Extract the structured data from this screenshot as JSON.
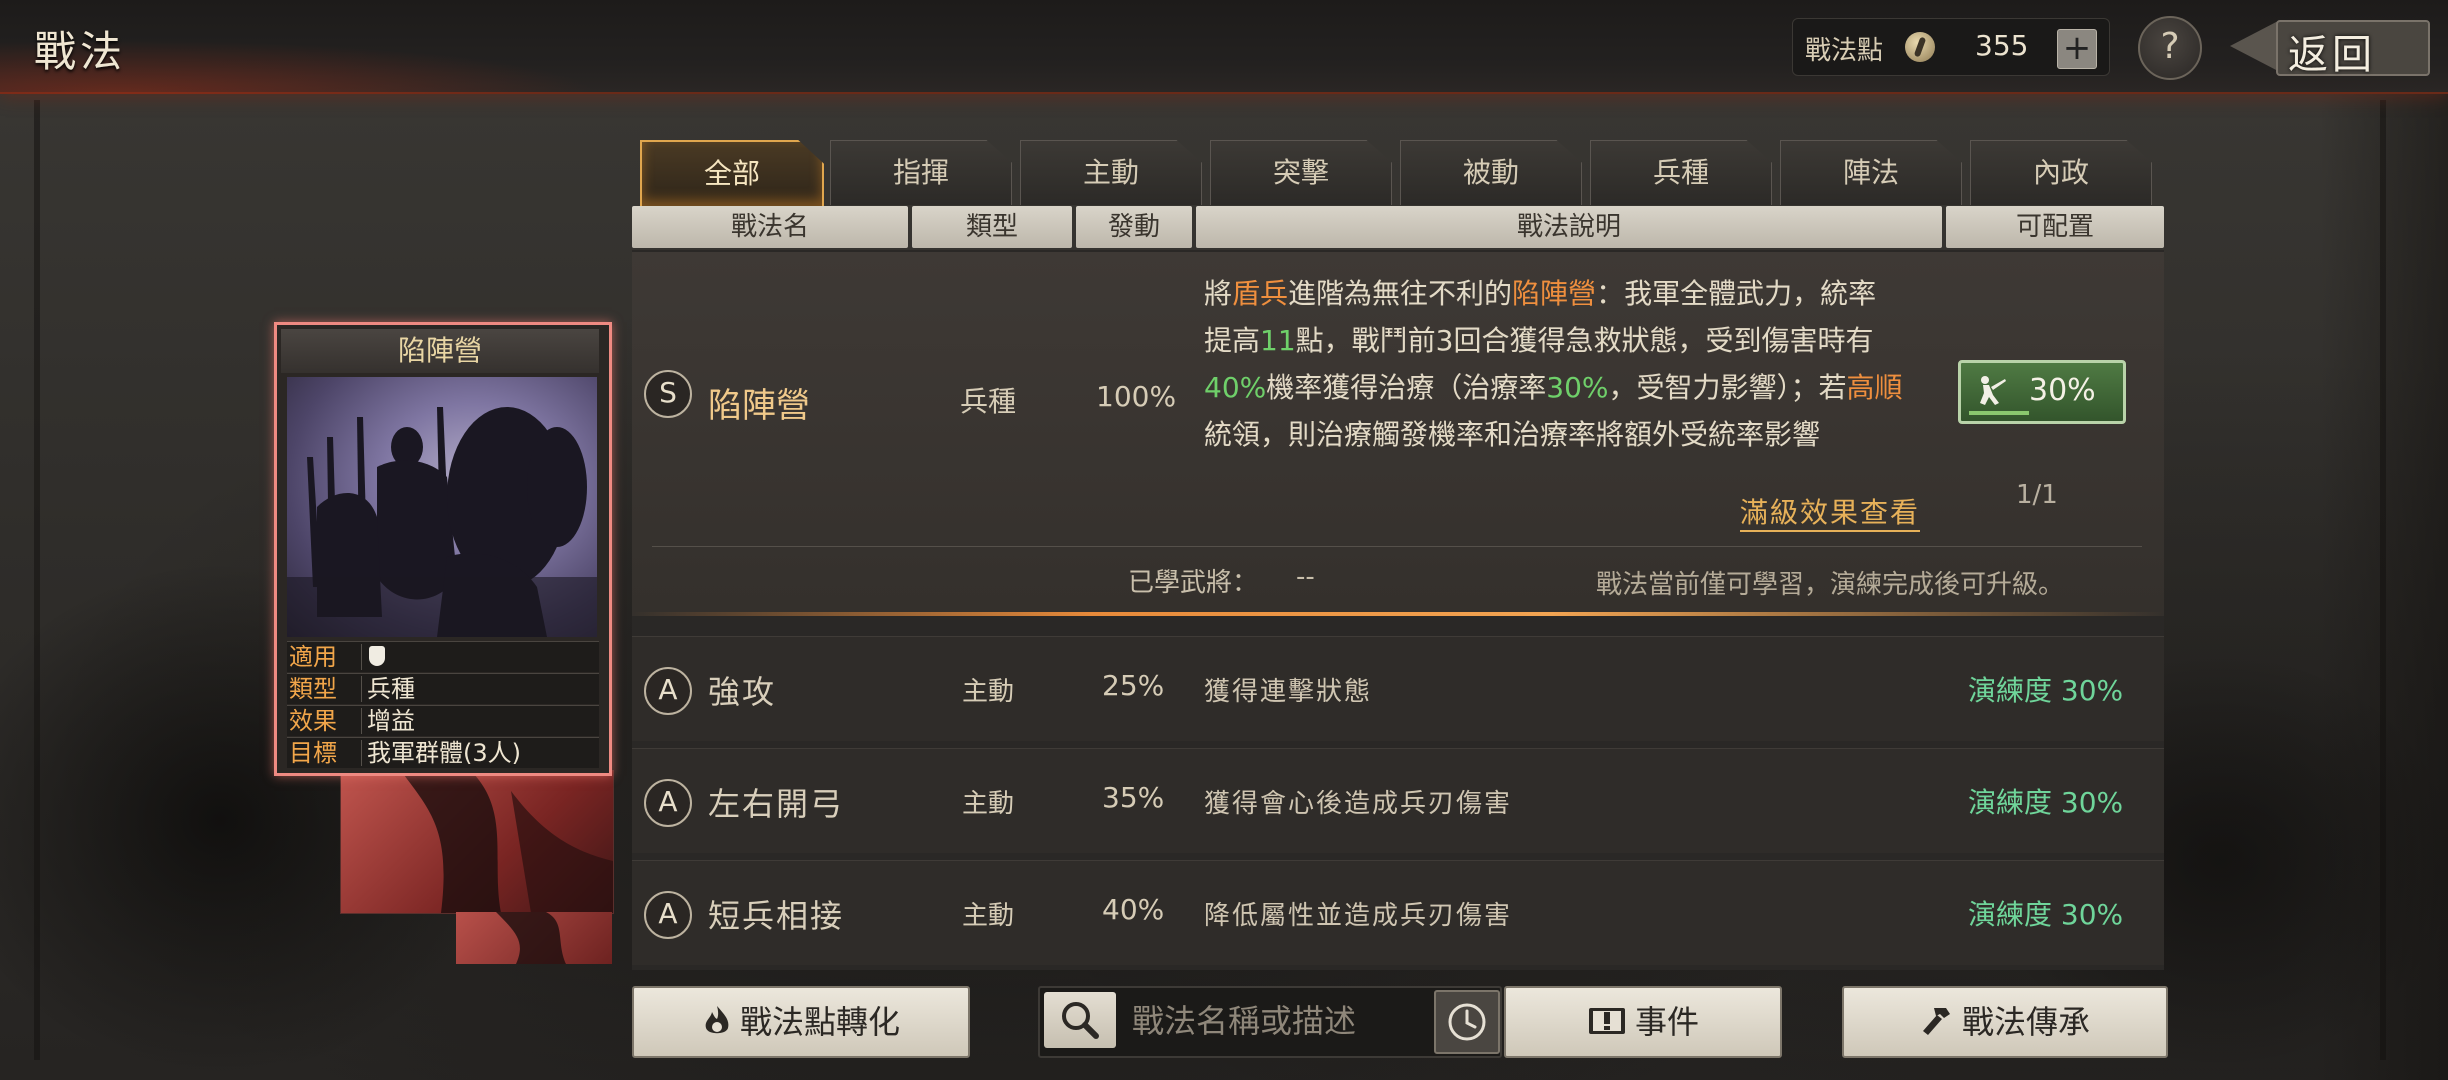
{
  "header": {
    "title": "戰法",
    "points_label": "戰法點",
    "points_value": "355",
    "add_label": "+",
    "help_label": "?",
    "back_label": "返回"
  },
  "tabs": [
    {
      "label": "全部",
      "active": true
    },
    {
      "label": "指揮",
      "active": false
    },
    {
      "label": "主動",
      "active": false
    },
    {
      "label": "突擊",
      "active": false
    },
    {
      "label": "被動",
      "active": false
    },
    {
      "label": "兵種",
      "active": false
    },
    {
      "label": "陣法",
      "active": false
    },
    {
      "label": "內政",
      "active": false
    }
  ],
  "columns": [
    "戰法名",
    "類型",
    "發動",
    "戰法說明",
    "可配置"
  ],
  "selected": {
    "grade": "S",
    "name": "陷陣營",
    "type": "兵種",
    "rate": "100%",
    "desc": {
      "p1": "將",
      "h1": "盾兵",
      "p2": "進階為無往不利的",
      "h2": "陷陣營",
      "p3": "：我軍全體武力，統率提高",
      "n1": "11",
      "p4": "點，戰鬥前3回合獲得急救狀態，受到傷害時有",
      "n2": "40%",
      "p5": "機率獲得治療（治療率",
      "n3": "30%",
      "p6": "，受智力影響）；若",
      "h3": "高順",
      "p7": "統領，則治療觸發機率和治療率將額外受統率影響"
    },
    "config_value": "30%",
    "config_count": "1/1",
    "max_effect_link": "滿級效果查看",
    "learned_label": "已學武將：",
    "learned_value": "--",
    "note": "戰法當前僅可學習，演練完成後可升級。"
  },
  "rows": [
    {
      "grade": "A",
      "name": "強攻",
      "type": "主動",
      "rate": "25%",
      "desc": "獲得連擊狀態",
      "proficiency": "演練度 30%"
    },
    {
      "grade": "A",
      "name": "左右開弓",
      "type": "主動",
      "rate": "35%",
      "desc": "獲得會心後造成兵刃傷害",
      "proficiency": "演練度 30%"
    },
    {
      "grade": "A",
      "name": "短兵相接",
      "type": "主動",
      "rate": "40%",
      "desc": "降低屬性並造成兵刃傷害",
      "proficiency": "演練度 30%"
    }
  ],
  "card": {
    "title": "陷陣營",
    "info": [
      {
        "key": "適用",
        "value": ""
      },
      {
        "key": "類型",
        "value": "兵種"
      },
      {
        "key": "效果",
        "value": "增益"
      },
      {
        "key": "目標",
        "value": "我軍群體(3人)"
      }
    ]
  },
  "bottom": {
    "convert_label": "戰法點轉化",
    "search_placeholder": "戰法名稱或描述",
    "events_label": "事件",
    "inherit_label": "戰法傳承"
  },
  "colors": {
    "accent_orange": "#ef8f3e",
    "highlight_green": "#6fd06a",
    "proficiency_green": "#6fd59a",
    "tab_active_border": "#e0a64e",
    "card_border": "#ef8a82"
  },
  "icons": [
    "coin-icon",
    "plus-icon",
    "help-icon",
    "back-arrow-icon",
    "troop-icon",
    "shield-icon",
    "flame-icon",
    "search-icon",
    "clock-icon",
    "book-icon",
    "hammer-icon"
  ]
}
